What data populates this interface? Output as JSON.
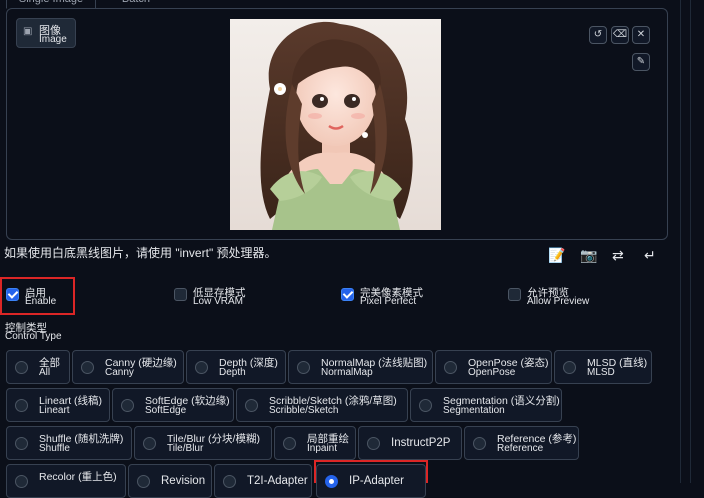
{
  "tabs": {
    "single": "Single Image",
    "batch": "Batch"
  },
  "image_label": {
    "line1": "图像",
    "line2": "Image"
  },
  "hint_text": "如果使用白底黑线图片，请使用 \"invert\" 预处理器。",
  "options": [
    {
      "l1": "启用",
      "l2": "Enable",
      "checked": true
    },
    {
      "l1": "低显存模式",
      "l2": "Low VRAM",
      "checked": false
    },
    {
      "l1": "完美像素模式",
      "l2": "Pixel Perfect",
      "checked": true
    },
    {
      "l1": "允许预览",
      "l2": "Allow Preview",
      "checked": false
    }
  ],
  "control_type": {
    "title": "控制类型",
    "subtitle": "Control Type"
  },
  "control_types": {
    "row1": [
      {
        "l1": "全部",
        "l2": "All"
      },
      {
        "l1": "Canny (硬边缘)",
        "l2": "Canny"
      },
      {
        "l1": "Depth (深度)",
        "l2": "Depth"
      },
      {
        "l1": "NormalMap (法线贴图)",
        "l2": "NormalMap"
      },
      {
        "l1": "OpenPose (姿态)",
        "l2": "OpenPose"
      },
      {
        "l1": "MLSD (直线)",
        "l2": "MLSD"
      }
    ],
    "row2": [
      {
        "l1": "Lineart (线稿)",
        "l2": "Lineart"
      },
      {
        "l1": "SoftEdge (软边缘)",
        "l2": "SoftEdge"
      },
      {
        "l1": "Scribble/Sketch (涂鸦/草图)",
        "l2": "Scribble/Sketch"
      },
      {
        "l1": "Segmentation (语义分割)",
        "l2": "Segmentation"
      }
    ],
    "row3": [
      {
        "l1": "Shuffle (随机洗牌)",
        "l2": "Shuffle"
      },
      {
        "l1": "Tile/Blur (分块/模糊)",
        "l2": "Tile/Blur"
      },
      {
        "l1": "局部重绘",
        "l2": "Inpaint"
      },
      {
        "single": "InstructP2P"
      },
      {
        "l1": "Reference (参考)",
        "l2": "Reference"
      }
    ],
    "row4": [
      {
        "l1": "Recolor (重上色)",
        "l2": ""
      },
      {
        "single": "Revision"
      },
      {
        "single": "T2I-Adapter"
      },
      {
        "single": "IP-Adapter",
        "selected": true
      }
    ]
  },
  "icons": {
    "undo": "undo-icon",
    "eraser": "eraser-icon",
    "close": "close-icon",
    "edit": "pen-icon",
    "notes": "notepad-icon",
    "camera": "camera-icon",
    "swap": "swap-arrows-icon",
    "send": "return-arrow-icon"
  },
  "colors": {
    "accent": "#2563eb",
    "highlight": "#dc2626",
    "background": "#0b0f19"
  }
}
